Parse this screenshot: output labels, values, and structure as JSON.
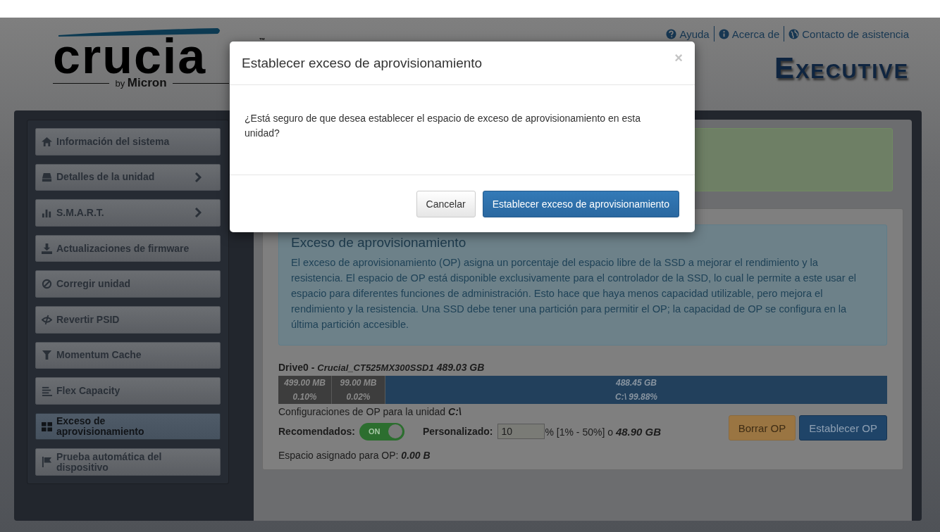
{
  "header": {
    "wordmark": "crucia",
    "tm": "™",
    "byline_prefix": "by",
    "byline_brand": "Micron",
    "product_title": "Executive",
    "links": [
      {
        "label": "Ayuda"
      },
      {
        "label": "Acerca de"
      },
      {
        "label": "Contacto de asistencia"
      }
    ]
  },
  "sidebar": {
    "items": [
      {
        "label": "Información del sistema",
        "has_arrow": false,
        "selected": false
      },
      {
        "label": "Detalles de la unidad",
        "has_arrow": true,
        "selected": false
      },
      {
        "label": "S.M.A.R.T.",
        "has_arrow": true,
        "selected": false
      },
      {
        "label": "Actualizaciones de firmware",
        "has_arrow": false,
        "selected": false
      },
      {
        "label": "Corregir unidad",
        "has_arrow": false,
        "selected": false
      },
      {
        "label": "Revertir PSID",
        "has_arrow": false,
        "selected": false
      },
      {
        "label": "Momentum Cache",
        "has_arrow": false,
        "selected": false
      },
      {
        "label": "Flex Capacity",
        "has_arrow": false,
        "selected": false
      },
      {
        "label": "Exceso de aprovisionamiento",
        "has_arrow": false,
        "selected": true
      },
      {
        "label": "Prueba automática del dispositivo",
        "has_arrow": false,
        "selected": false
      }
    ]
  },
  "section": {
    "title": "Exceso de aprovisionamiento",
    "description": "El exceso de aprovisionamiento (OP) asigna un porcentaje del espacio libre de la SSD a mejorar el rendimiento y la resistencia. El espacio de OP está disponible exclusivamente para el controlador de la SSD, lo cual le permite a este usar el espacio para diferentes funciones de administración. Esto hace que haya menos capacidad utilizable, pero mejora el rendimiento y la resistencia. Una SSD debe tener una partición para permitir el OP; la capacidad de OP se configura en la última partición accesible.",
    "drive": {
      "name": "Drive0 -",
      "model": "Crucial_CT525MX300SSD1",
      "size": "489.03 GB"
    },
    "partitions": [
      {
        "kind": "reserved",
        "size": "499.00 MB",
        "percent": "0.10%"
      },
      {
        "kind": "reserved",
        "size": "99.00 MB",
        "percent": "0.02%"
      },
      {
        "kind": "primary",
        "size": "488.45 GB",
        "percent": "C:\\ 99.88%"
      }
    ],
    "op_label": "Configuraciones de OP para la unidad",
    "op_drive": "C:\\",
    "recommended": {
      "label": "Recomendados:",
      "toggle_label": "ON",
      "on": true
    },
    "custom": {
      "label": "Personalizado:",
      "value": "10",
      "range": "% [1% - 50%] o",
      "size": "48.90 GB"
    },
    "buttons": [
      {
        "label": "Borrar OP",
        "kind": "warning"
      },
      {
        "label": "Establecer OP",
        "kind": "primary"
      }
    ],
    "allocated": {
      "label": "Espacio asignado para OP:",
      "value": "0.00 B"
    }
  },
  "modal": {
    "title": "Establecer exceso de aprovisionamiento",
    "close": "×",
    "message": "¿Está seguro de que desea establecer el espacio de exceso de aprovisionamiento en esta unidad?",
    "buttons": [
      {
        "label": "Cancelar",
        "kind": "default"
      },
      {
        "label": "Establecer exceso de aprovisionamiento",
        "kind": "primary"
      }
    ]
  }
}
